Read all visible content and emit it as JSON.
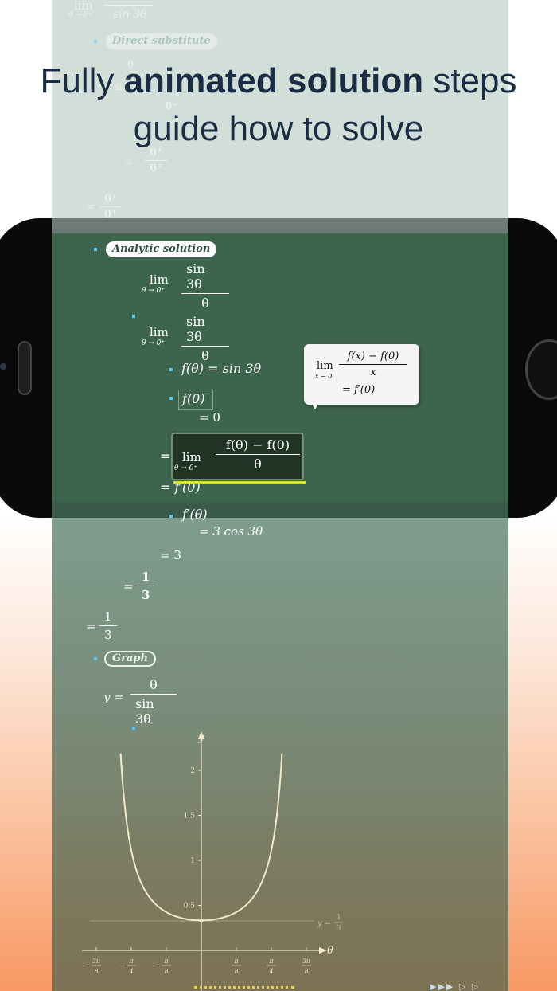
{
  "headline": {
    "line1_pre": "Fully ",
    "line1_bold": "animated solution",
    "line1_post": " steps",
    "line2": "guide how to solve"
  },
  "top_ghost": {
    "lim": "lim",
    "lim_sub": "θ → 0⁺",
    "den": "sin 3θ",
    "direct_label": "Direct substitute",
    "num1": "0",
    "sin_short": "si",
    "zero_plus": "0⁺",
    "arrow": "→",
    "eq": "=",
    "zero": "0",
    "zero_plus_num": "0⁺",
    "zero_plus_den": "0⁺"
  },
  "analytic": {
    "label": "Analytic solution",
    "lim": "lim",
    "lim_sub": "θ → 0⁺",
    "num": "sin 3θ",
    "den": "θ",
    "f_def": "f(θ) = sin 3θ",
    "f0": "f(0)",
    "eq0": "= 0",
    "box_num": "f(θ) − f(0)",
    "box_den": "θ",
    "eq": "=",
    "fprime0": "= f′(0)",
    "fprime": "f′(θ)",
    "cos": "= 3 cos 3θ",
    "eq3": "= 3",
    "one": "1",
    "three": "3",
    "eq_sign": "="
  },
  "callout": {
    "lim": "lim",
    "lim_sub": "x → 0",
    "num": "f(x) − f(0)",
    "den": "x",
    "result": "= f′(0)"
  },
  "graph": {
    "label": "Graph",
    "y_eq": "y =",
    "num": "θ",
    "den": "sin 3θ",
    "y_axis": "y",
    "x_axis": "θ",
    "asymptote_label": "y =",
    "asymptote_num": "1",
    "asymptote_den": "3",
    "y_ticks": [
      "2",
      "1.5",
      "1",
      "0.5"
    ],
    "x_ticks": [
      {
        "sign": "−",
        "num": "3π",
        "den": "8"
      },
      {
        "sign": "−",
        "num": "π",
        "den": "4"
      },
      {
        "sign": "−",
        "num": "π",
        "den": "8"
      },
      {
        "sign": "",
        "num": "π",
        "den": "8"
      },
      {
        "sign": "",
        "num": "π",
        "den": "4"
      },
      {
        "sign": "",
        "num": "3π",
        "den": "8"
      }
    ],
    "nav_arrows": "▶▶▶ ▷ ▷"
  },
  "colors": {
    "headline": "#1b2d44",
    "board": "#3d654e",
    "accent_dot": "#5fc6f2",
    "curve": "#f3e8c8"
  }
}
